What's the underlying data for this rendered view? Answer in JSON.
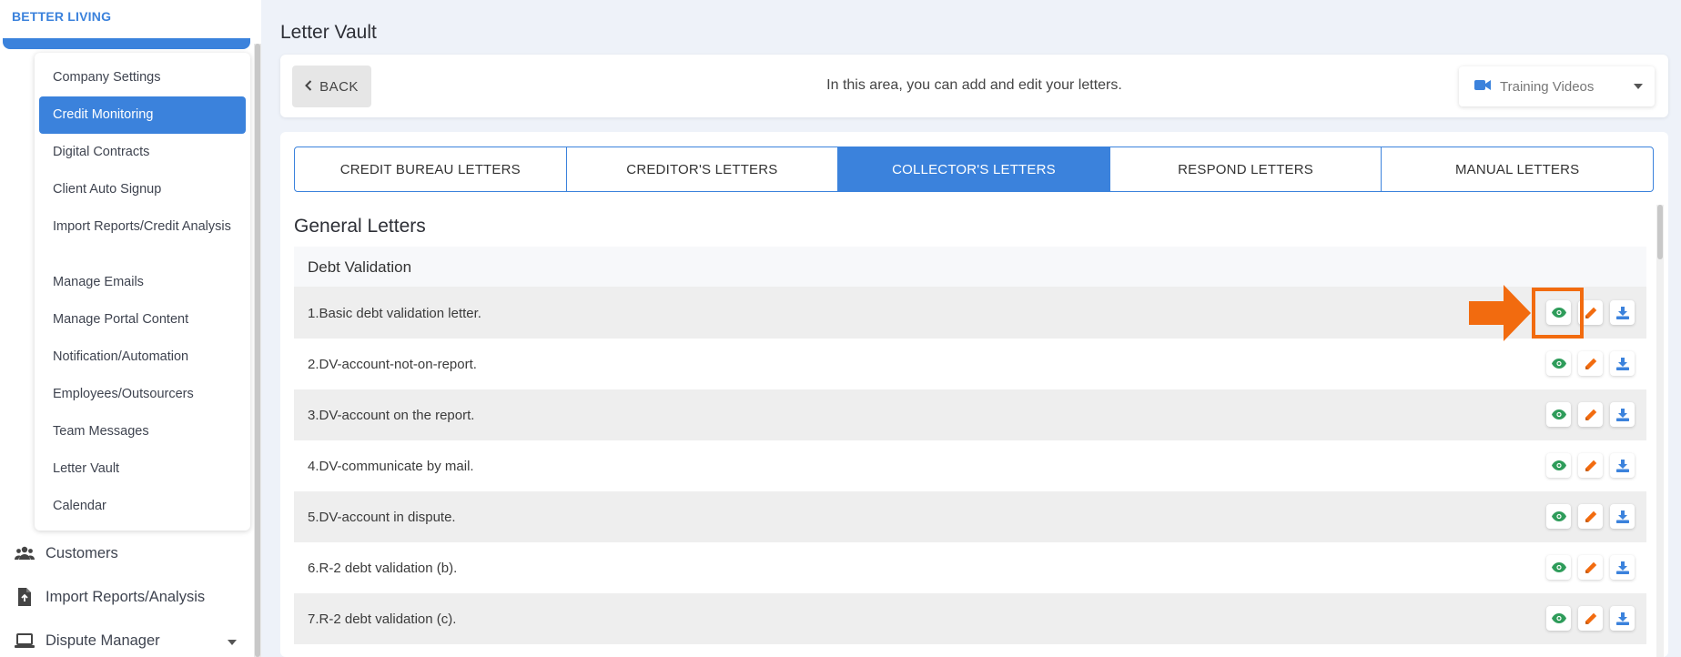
{
  "sidebar": {
    "brand": "BETTER LIVING",
    "submenu": [
      {
        "label": "Company Settings"
      },
      {
        "label": "Credit Monitoring",
        "active": true
      },
      {
        "label": "Digital Contracts"
      },
      {
        "label": "Client Auto Signup"
      },
      {
        "label": "Import Reports/Credit Analysis"
      },
      {
        "label": "Manage Emails"
      },
      {
        "label": "Manage Portal Content"
      },
      {
        "label": "Notification/Automation"
      },
      {
        "label": "Employees/Outsourcers"
      },
      {
        "label": "Team Messages"
      },
      {
        "label": "Letter Vault"
      },
      {
        "label": "Calendar"
      }
    ],
    "nav": [
      {
        "label": "Customers",
        "icon": "users-icon"
      },
      {
        "label": "Import Reports/Analysis",
        "icon": "file-import-icon"
      },
      {
        "label": "Dispute Manager",
        "icon": "laptop-icon"
      }
    ]
  },
  "page": {
    "title": "Letter Vault",
    "back_label": "BACK",
    "info": "In this area, you can add and edit your letters.",
    "training_videos": "Training Videos"
  },
  "tabs": [
    {
      "label": "CREDIT BUREAU LETTERS"
    },
    {
      "label": "CREDITOR'S LETTERS"
    },
    {
      "label": "COLLECTOR'S LETTERS",
      "active": true
    },
    {
      "label": "RESPOND LETTERS"
    },
    {
      "label": "MANUAL LETTERS"
    }
  ],
  "section": {
    "title": "General Letters",
    "group": "Debt Validation",
    "letters": [
      "1.Basic debt validation letter.",
      "2.DV-account-not-on-report.",
      "3.DV-account on the report.",
      "4.DV-communicate by mail.",
      "5.DV-account in dispute.",
      "6.R-2 debt validation (b).",
      "7.R-2 debt validation (c)."
    ]
  },
  "colors": {
    "accent": "#3b82dc",
    "view": "#2e9c5a",
    "edit": "#f26b0f",
    "download": "#3b82dc",
    "highlight": "#f26b0f"
  }
}
